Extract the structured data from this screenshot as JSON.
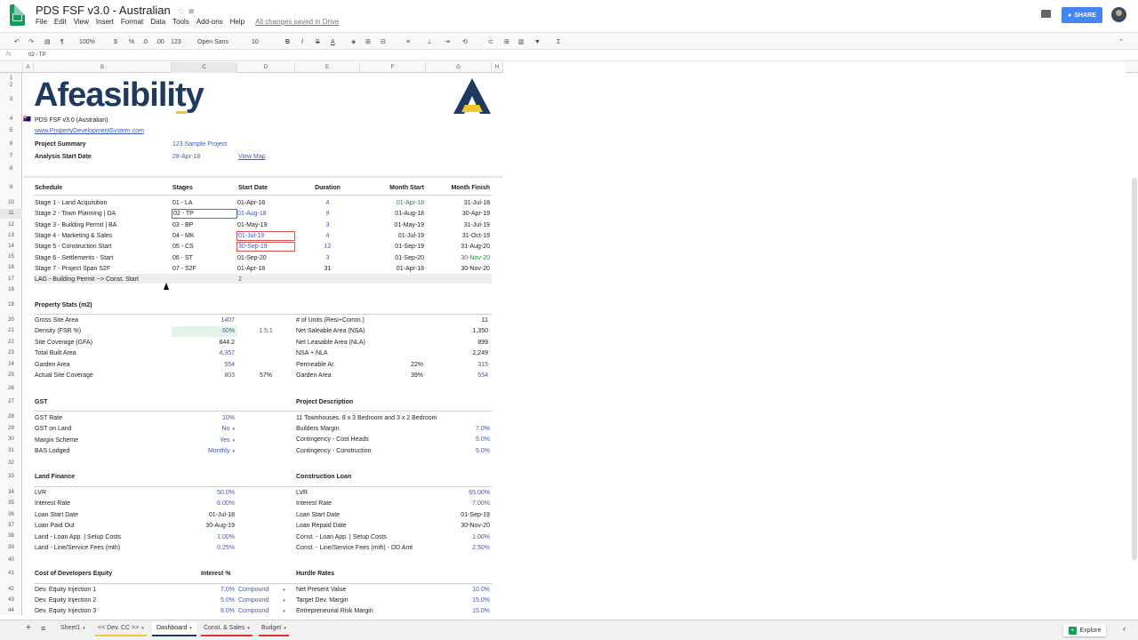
{
  "app": {
    "title": "PDS FSF v3.0 - Australian",
    "menu": [
      "File",
      "Edit",
      "View",
      "Insert",
      "Format",
      "Data",
      "Tools",
      "Add-ons",
      "Help"
    ],
    "saved_status": "All changes saved in Drive",
    "share_label": "SHARE"
  },
  "toolbar": {
    "zoom": "100%",
    "currency": "$",
    "percent": "%",
    "dec_less": ".0",
    "dec_more": ".00",
    "format_more": "123",
    "font": "Open Sans",
    "font_size": "10"
  },
  "formula_bar": {
    "fx": "fx",
    "content": "02 - TP"
  },
  "columns": [
    "A",
    "B",
    "C",
    "D",
    "E",
    "F",
    "G",
    "H"
  ],
  "rows": [
    "1",
    "2",
    "3",
    "4",
    "5",
    "6",
    "7",
    "8",
    "9",
    "10",
    "11",
    "12",
    "13",
    "14",
    "15",
    "16",
    "17",
    "18",
    "19",
    "20",
    "21",
    "22",
    "23",
    "24",
    "25",
    "26",
    "27",
    "28",
    "29",
    "30",
    "31",
    "32",
    "33",
    "34",
    "35",
    "36",
    "37",
    "38",
    "39",
    "40",
    "41",
    "42",
    "43",
    "44"
  ],
  "logo_text": "Afeasibility",
  "header": {
    "version": "PDS FSF v3.0 (Australian)",
    "website": "www.PropertyDevelopmentSystem.com",
    "project_summary_label": "Project Summary",
    "project_summary_value": "123 Sample Project",
    "analysis_start_label": "Analysis Start Date",
    "analysis_start_value": "28-Apr-18",
    "view_map": "View Map"
  },
  "schedule": {
    "headers": [
      "Schedule",
      "Stages",
      "Start Date",
      "Duration",
      "Month Start",
      "Month Finish"
    ],
    "rows": [
      [
        "Stage 1 - Land Acquisition",
        "01 - LA",
        "01-Apr-18",
        "4",
        "01-Apr-18",
        "31-Jul-18"
      ],
      [
        "Stage 2 - Town Planning | DA",
        "02 - TP",
        "01-Aug-18",
        "9",
        "01-Aug-18",
        "30-Apr-19"
      ],
      [
        "Stage 3 - Building Permit | BA",
        "03 - BP",
        "01-May-19",
        "3",
        "01-May-19",
        "31-Jul-19"
      ],
      [
        "Stage 4 - Marketing & Sales",
        "04 - MK",
        "01-Jul-19",
        "4",
        "01-Jul-19",
        "31-Oct-19"
      ],
      [
        "Stage 5 - Construction Start",
        "05 - CS",
        "30-Sep-19",
        "12",
        "01-Sep-19",
        "31-Aug-20"
      ],
      [
        "Stage 6 - Settlements - Start",
        "06 - ST",
        "01-Sep-20",
        "3",
        "01-Sep-20",
        "30-Nov-20"
      ],
      [
        "Stage 7 - Project Span S2F",
        "07 - S2F",
        "01-Apr-18",
        "31",
        "01-Apr-18",
        "30-Nov-20"
      ]
    ],
    "lag_label": "LAG - Building Permit --> Const. Start",
    "lag_value": "2"
  },
  "property_stats": {
    "title": "Property Stats (m2)",
    "left": [
      [
        "Gross Site Area",
        "1407",
        ""
      ],
      [
        "Density (FSR %)",
        "60%",
        "1.5:1"
      ],
      [
        "Site Coverage (GFA)",
        "844.2",
        ""
      ],
      [
        "Total Built Area",
        "4,357",
        ""
      ],
      [
        "Garden Area",
        "554",
        ""
      ],
      [
        "Actual Site Coverage",
        "803",
        "57%"
      ]
    ],
    "right": [
      [
        "# of Units (Resi+Comm.)",
        "",
        "11"
      ],
      [
        "Net Saleable Area (NSA)",
        "",
        "1,350"
      ],
      [
        "Net Leasable Area (NLA)",
        "",
        "899"
      ],
      [
        "NSA + NLA",
        "",
        "2,249"
      ],
      [
        "Permeable Ar.",
        "22%",
        "315"
      ],
      [
        "Garden Area",
        "39%",
        "554"
      ]
    ]
  },
  "gst": {
    "title": "GST",
    "rows": [
      [
        "GST Rate",
        "10%"
      ],
      [
        "GST on Land",
        "No"
      ],
      [
        "Margin Scheme",
        "Yes"
      ],
      [
        "BAS Lodged",
        "Monthly"
      ]
    ]
  },
  "project_description": {
    "title": "Project Description",
    "text": "11 Townhouses. 8 x 3 Bedroom and 3 x 2 Bedroom",
    "rows": [
      [
        "Builders Margin",
        "7.0%"
      ],
      [
        "Contingency - Cost Heads",
        "5.0%"
      ],
      [
        "Contingency - Construction",
        "5.0%"
      ]
    ]
  },
  "land_finance": {
    "title": "Land Finance",
    "rows": [
      [
        "LVR",
        "50.0%"
      ],
      [
        "Interest Rate",
        "6.00%"
      ],
      [
        "Loan Start Date",
        "01-Jul-18"
      ],
      [
        "Loan Paid Out",
        "30-Aug-19"
      ],
      [
        "Land - Loan App. | Setup Costs",
        "1.00%"
      ],
      [
        "Land - Line/Service Fees  (mth)",
        "0.25%"
      ]
    ]
  },
  "construction_loan": {
    "title": "Construction Loan",
    "rows": [
      [
        "LVR",
        "65.00%"
      ],
      [
        "Interest Rate",
        "7.00%"
      ],
      [
        "Loan Start Date",
        "01-Sep-19"
      ],
      [
        "Loan Repaid Date",
        "30-Nov-20"
      ],
      [
        "Const. - Loan App. | Setup Costs",
        "1.00%"
      ],
      [
        "Const. - Line/Service Fees (mth) - DD Amt",
        "2.50%"
      ]
    ]
  },
  "developers_equity": {
    "title": "Cost of Developers Equity",
    "interest_header": "Interest %",
    "rows": [
      [
        "Dev. Equity Injection 1",
        "7.0%",
        "Compound"
      ],
      [
        "Dev. Equity Injection 2",
        "5.0%",
        "Compound"
      ],
      [
        "Dev. Equity Injection 3",
        "8.0%",
        "Compound"
      ]
    ]
  },
  "hurdle_rates": {
    "title": "Hurdle Rates",
    "rows": [
      [
        "Net Present Value",
        "10.0%"
      ],
      [
        "Target Dev. Margin",
        "15.0%"
      ],
      [
        "Entrepreneurial Risk Margin",
        "15.0%"
      ]
    ]
  },
  "tabs": [
    "Sheet1",
    "<< Dev. CC >>",
    "Dashboard",
    "Const. & Sales",
    "Budget"
  ],
  "explore_label": "Explore",
  "colors": {
    "accent_blue": "#3c58b8",
    "green": "#1e8e3e",
    "brand_navy": "#1e3a5f",
    "brand_yellow": "#f2c72c",
    "share_blue": "#4285f4"
  }
}
